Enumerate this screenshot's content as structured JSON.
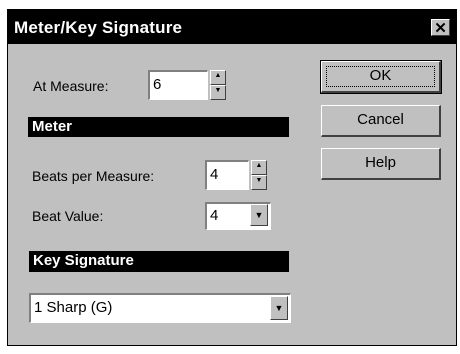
{
  "window": {
    "title": "Meter/Key Signature",
    "close_glyph": "✕"
  },
  "at_measure": {
    "label": "At Measure:",
    "value": "6"
  },
  "meter": {
    "header": "Meter",
    "beats_per_measure_label": "Beats per Measure:",
    "beats_per_measure_value": "4",
    "beat_value_label": "Beat Value:",
    "beat_value_value": "4"
  },
  "key_signature": {
    "header": "Key Signature",
    "selected": "1 Sharp (G)"
  },
  "buttons": {
    "ok": "OK",
    "cancel": "Cancel",
    "help": "Help"
  },
  "icons": {
    "spin_up": "▲",
    "spin_down": "▼",
    "dropdown": "▼"
  }
}
